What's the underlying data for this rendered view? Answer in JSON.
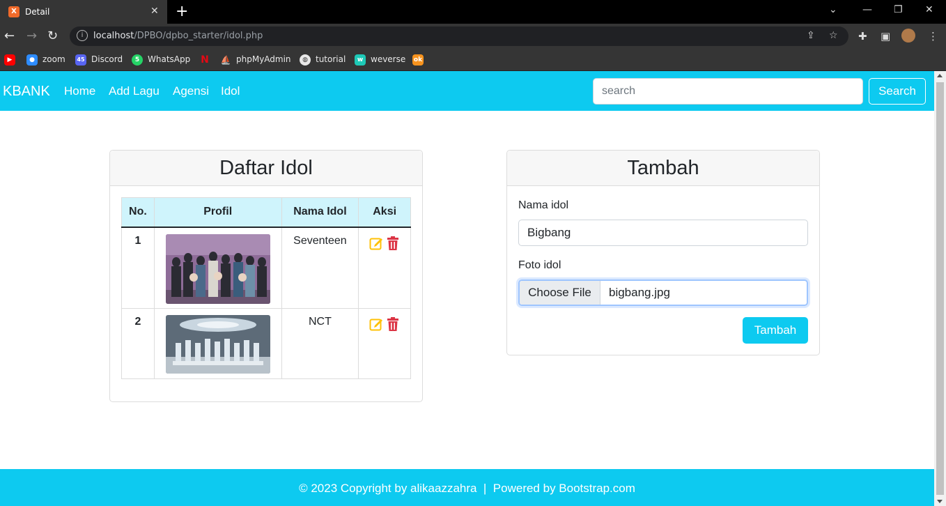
{
  "browser": {
    "tab_title": "Detail",
    "tab_icon_label": "X",
    "url_host": "localhost",
    "url_path": "/DPBO/dpbo_starter/idol.php",
    "bookmarks": [
      {
        "label": "",
        "icon": "youtube-icon",
        "color": "#ff0000"
      },
      {
        "label": "zoom",
        "icon": "zoom-icon",
        "color": "#2d8cff"
      },
      {
        "label": "Discord",
        "icon": "discord-icon",
        "color": "#5865f2",
        "badge": "45"
      },
      {
        "label": "WhatsApp",
        "icon": "whatsapp-icon",
        "color": "#25d366",
        "badge": "5"
      },
      {
        "label": "",
        "icon": "netflix-icon",
        "color": "#e50914"
      },
      {
        "label": "phpMyAdmin",
        "icon": "phpmyadmin-icon",
        "color": "#f89c0e"
      },
      {
        "label": "tutorial",
        "icon": "globe-icon",
        "color": "#e8e8e8"
      },
      {
        "label": "weverse",
        "icon": "weverse-icon",
        "color": "#1ec9b7"
      },
      {
        "label": "",
        "icon": "odnoklassniki-icon",
        "color": "#f7931e"
      }
    ]
  },
  "navbar": {
    "brand": "KBANK",
    "links": [
      "Home",
      "Add Lagu",
      "Agensi",
      "Idol"
    ],
    "search_placeholder": "search",
    "search_button": "Search",
    "color": "#0dcaf0"
  },
  "idol_list": {
    "title": "Daftar Idol",
    "columns": [
      "No.",
      "Profil",
      "Nama Idol",
      "Aksi"
    ],
    "rows": [
      {
        "no": "1",
        "name": "Seventeen",
        "photo": "group-photo-purple"
      },
      {
        "no": "2",
        "name": "NCT",
        "photo": "group-photo-stage"
      }
    ]
  },
  "add_form": {
    "title": "Tambah",
    "name_label": "Nama idol",
    "name_value": "Bigbang",
    "photo_label": "Foto idol",
    "file_button": "Choose File",
    "file_name": "bigbang.jpg",
    "submit": "Tambah"
  },
  "footer": {
    "text": "© 2023 Copyright by alikaazzahra  |  Powered by Bootstrap.com"
  }
}
